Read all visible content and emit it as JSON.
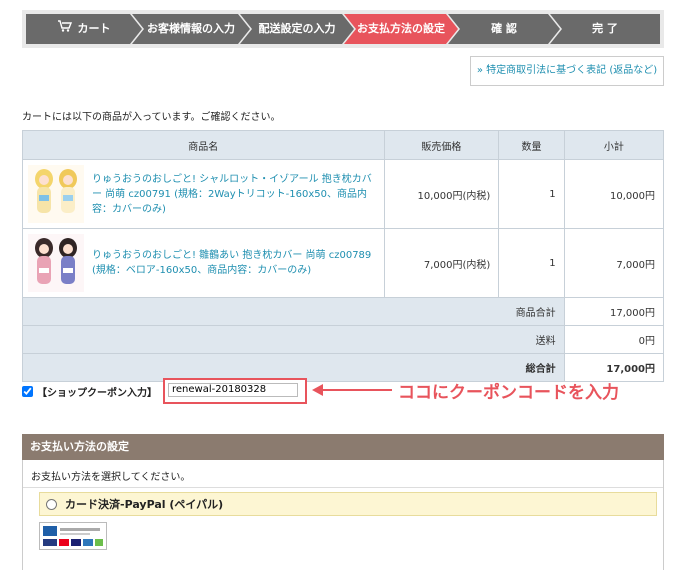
{
  "steps": [
    {
      "label": "カート",
      "active": false
    },
    {
      "label": "お客様情報の入力",
      "active": false
    },
    {
      "label": "配送設定の入力",
      "active": false
    },
    {
      "label": "お支払方法の設定",
      "active": true
    },
    {
      "label": "確 認",
      "active": false
    },
    {
      "label": "完 了",
      "active": false
    }
  ],
  "law_link": "» 特定商取引法に基づく表記 (返品など)",
  "intro": "カートには以下の商品が入っています。ご確認ください。",
  "table": {
    "headers": [
      "商品名",
      "販売価格",
      "数量",
      "小計"
    ],
    "rows": [
      {
        "name": "りゅうおうのおしごと! シャルロット・イゾアール 抱き枕カバー 尚萌 cz00791 (規格：2Wayトリコット-160x50、商品内容：カバーのみ)",
        "price": "10,000円(内税)",
        "qty": "1",
        "subtotal": "10,000円"
      },
      {
        "name": "りゅうおうのおしごと! 雛鶴あい 抱き枕カバー 尚萌 cz00789 (規格：ベロア-160x50、商品内容：カバーのみ)",
        "price": "7,000円(内税)",
        "qty": "1",
        "subtotal": "7,000円"
      }
    ],
    "summary": [
      {
        "label": "商品合計",
        "value": "17,000円"
      },
      {
        "label": "送料",
        "value": "0円"
      },
      {
        "label": "総合計",
        "value": "17,000円"
      }
    ]
  },
  "coupon": {
    "label": "【ショップクーポン入力】",
    "value": "renewal-20180328",
    "checked": true
  },
  "annotation": "ココにクーポンコードを入力",
  "payment": {
    "heading": "お支払い方法の設定",
    "message": "お支払い方法を選択してください。",
    "option": "カード決済-PayPal (ペイパル)"
  },
  "colors": {
    "accent": "#e8545c",
    "step_bg": "#6a6a6a",
    "link": "#1f8fb0",
    "pay_header": "#8b7b6f"
  }
}
